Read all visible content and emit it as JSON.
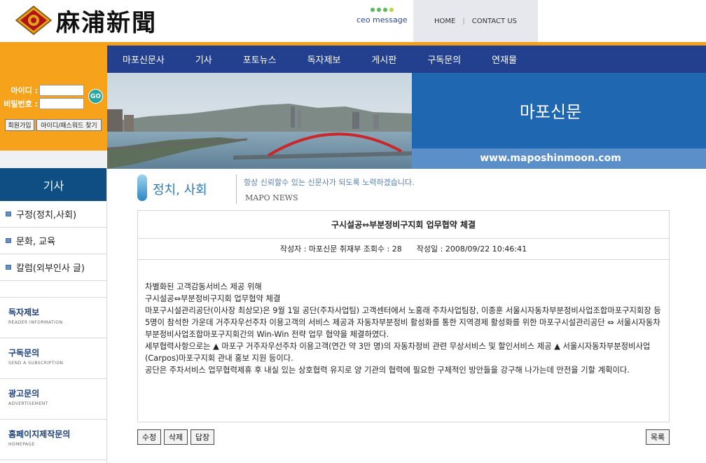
{
  "header": {
    "logo_text": "麻浦新聞",
    "ceo_message": "ceo message",
    "links": {
      "home": "HOME",
      "sep": "|",
      "contact": "CONTACT US"
    }
  },
  "colors": {
    "accent_orange": "#f7a21b",
    "nav_blue": "#23408f",
    "banner_blue": "#1f67b1",
    "side_title": "#0e4e82"
  },
  "login": {
    "id_label": "아이디 :",
    "pw_label": "비밀번호 :",
    "id_value": "",
    "pw_value": "",
    "go_label": "GO",
    "join_label": "회원가입",
    "find_label": "아이디/패스워드 찾기"
  },
  "nav": {
    "items": [
      "마포신문사",
      "기사",
      "포토뉴스",
      "독자제보",
      "게시판",
      "구독문의",
      "연재물"
    ]
  },
  "banner": {
    "title": "마포신문",
    "url": "www.maposhinmoon.com"
  },
  "sidebar": {
    "title": "기사",
    "items": [
      "구정(정치,사회)",
      "문화, 교육",
      "칼럼(외부인사 글)"
    ],
    "links": [
      {
        "title": "독자제보",
        "sub": "READER INFORMATION"
      },
      {
        "title": "구독문의",
        "sub": "SEND A SUBSCRIPTION"
      },
      {
        "title": "광고문의",
        "sub": "ADVERTISEMENT"
      },
      {
        "title": "홈페이지제작문의",
        "sub": "HOMEPAGE"
      }
    ]
  },
  "section": {
    "title": "정치, 사회",
    "slogan": "항상 신뢰할수 있는 신문사가 되도록 노력하겠습니다.",
    "sub": "MAPO NEWS"
  },
  "article": {
    "title": "구시설공⇔부분정비구지회 업무협약 체결",
    "meta": "작성자 : 마포신문 취재부 조회수 : 28      작성일 : 2008/09/22 10:46:41",
    "paragraphs": [
      "차별화된 고객감동서비스 제공 위해",
      "구시설공⇔부분정비구지회 업무협약 체결",
      "마포구시설관리공단(이사장 최상모)은 9월 1일 공단(주차사업팀) 고객센터에서 노홍래 주차사업팀장, 이종훈 서울시자동차부분정비사업조합마포구지회장 등 5명이 참석한 가운데 거주자우선주차 이용고객의 서비스 제공과 자동차부분정비 활성화를 통한 지역경제 활성화를 위한 마포구시설관리공단 ⇔ 서울시자동차부분정비사업조합마포구지회간의 Win-Win 전략 업무 협약을 체결하였다.",
      "세부협력사항으로는 ▲ 마포구 거주자우선주차 이용고객(연간 약 3만 명)의 자동차정비 관련 무상서비스 및 할인서비스 제공 ▲ 서울시자동차부분정비사업(Carpos)마포구지회 관내 홍보 지원 등이다.",
      "공단은 주차서비스 업무협력제휴 후 내실 있는 상호협력 유지로 양 기관의 협력에 필요한 구체적인 방안들을 강구해 나가는데 만전을 기할 계획이다."
    ]
  },
  "buttons": {
    "edit": "수정",
    "delete": "삭제",
    "reply": "답장",
    "list": "목록"
  }
}
